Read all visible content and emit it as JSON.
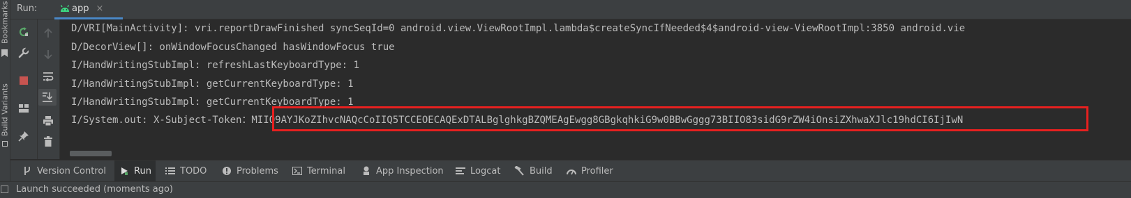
{
  "side_strip": {
    "bookmarks_label": "Bookmarks",
    "build_variants_label": "Build Variants"
  },
  "run_panel": {
    "label": "Run:",
    "tab_label": "app",
    "tab_close": "×"
  },
  "toolbar": {
    "icons": [
      "rerun-icon",
      "wrench-icon",
      "stop-icon",
      "layout-icon",
      "pin-icon",
      "up-arrow-icon",
      "down-arrow-icon",
      "soft-wrap-icon",
      "scroll-to-end-icon",
      "print-icon",
      "trash-icon"
    ]
  },
  "console": {
    "lines": [
      "D/VRI[MainActivity]: vri.reportDrawFinished syncSeqId=0 android.view.ViewRootImpl.lambda$createSyncIfNeeded$4$android-view-ViewRootImpl:3850 android.vie",
      "D/DecorView[]: onWindowFocusChanged hasWindowFocus true",
      "I/HandWritingStubImpl: refreshLastKeyboardType: 1",
      "I/HandWritingStubImpl: getCurrentKeyboardType: 1",
      "I/HandWritingStubImpl: getCurrentKeyboardType: 1",
      "I/System.out: X-Subject-Token：MIIQ9AYJKoZIhvcNAQcCoIIQ5TCCEOECAQExDTALBglghkgBZQMEAgEwgg8GBgkqhkiG9w0BBwGggg73BIIO83sidG9rZW4iOnsiZXhwaXJlc19hdCI6IjIwN"
    ]
  },
  "bottom_tabs": [
    {
      "label": "Version Control",
      "icon": "branch-icon"
    },
    {
      "label": "Run",
      "icon": "play-icon"
    },
    {
      "label": "TODO",
      "icon": "list-icon"
    },
    {
      "label": "Problems",
      "icon": "info-icon"
    },
    {
      "label": "Terminal",
      "icon": "terminal-icon"
    },
    {
      "label": "App Inspection",
      "icon": "inspection-icon"
    },
    {
      "label": "Logcat",
      "icon": "logcat-icon"
    },
    {
      "label": "Build",
      "icon": "hammer-icon"
    },
    {
      "label": "Profiler",
      "icon": "gauge-icon"
    }
  ],
  "status": {
    "text": "Launch succeeded (moments ago)"
  },
  "colors": {
    "background": "#2b2b2b",
    "panel": "#3c3f41",
    "highlight_border": "#e8201f",
    "rerun_green": "#59a869",
    "stop_red": "#c75450",
    "android_green": "#3ddc84"
  }
}
